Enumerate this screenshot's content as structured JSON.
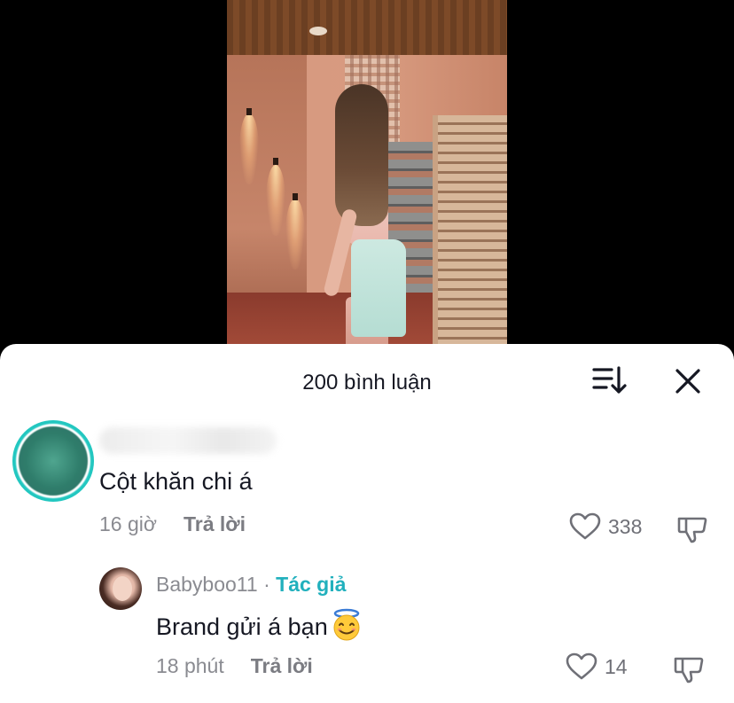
{
  "header": {
    "comment_count_title": "200 bình luận",
    "sort_icon": "sort-descending-icon",
    "close_icon": "close-icon"
  },
  "comments": [
    {
      "author": "",
      "text": "Cột khăn chi á",
      "time": "16 giờ",
      "reply_label": "Trả lời",
      "likes": "338",
      "avatar_ring_color": "#22c7c0"
    }
  ],
  "replies": [
    {
      "author": "Babyboo11",
      "separator": "·",
      "badge": "Tác giả",
      "text": "Brand gửi á bạn",
      "emoji": "smiling-face-with-halo-icon",
      "time": "18 phút",
      "reply_label": "Trả lời",
      "likes": "14"
    }
  ],
  "colors": {
    "author_badge": "#21b0bd",
    "text": "#161823",
    "meta": "#8a8b91"
  }
}
